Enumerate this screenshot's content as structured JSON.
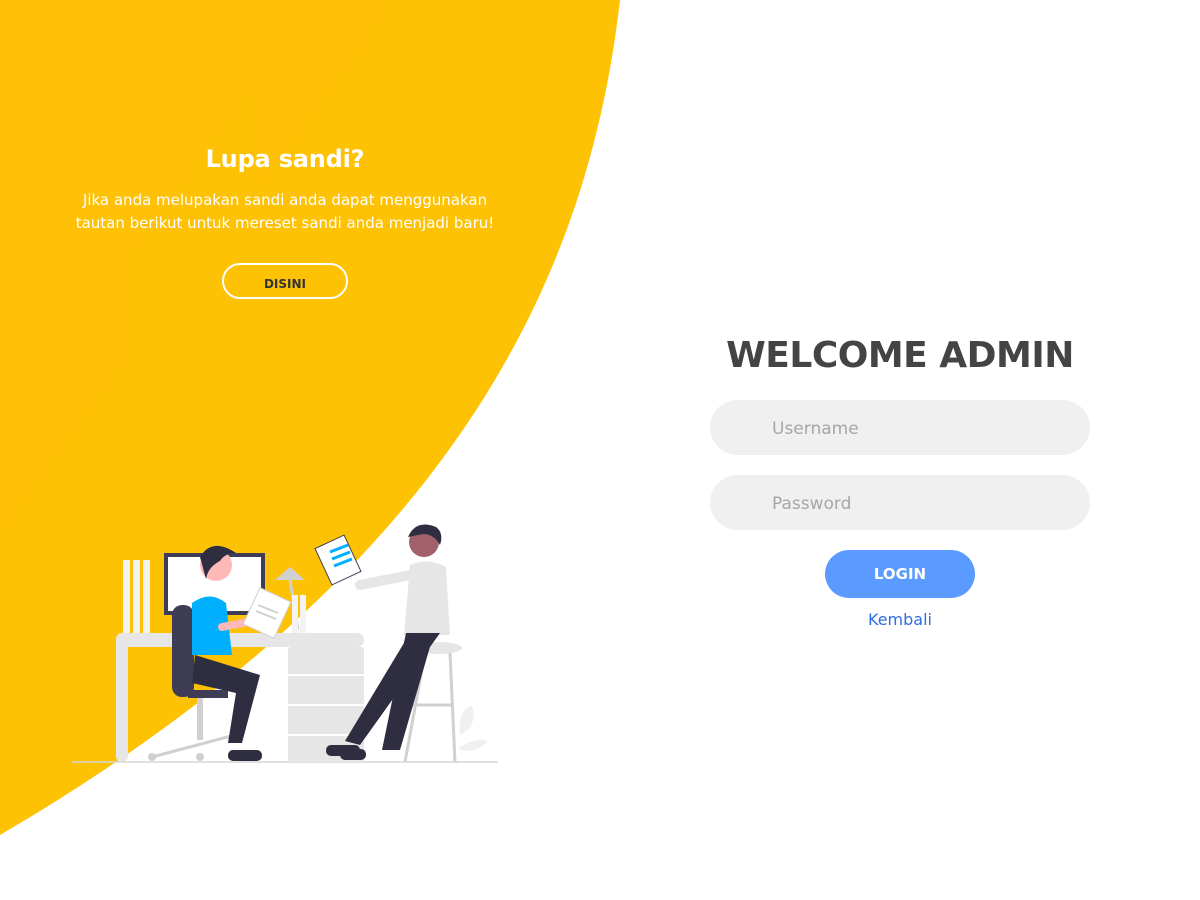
{
  "colors": {
    "accent": "#fcc200",
    "login_button": "#5b9bff",
    "link": "#2f6ee0",
    "title": "#444444"
  },
  "left_panel": {
    "title": "Lupa sandi?",
    "description": "Jika anda melupakan sandi anda dapat menggunakan tautan berikut untuk mereset sandi anda menjadi baru!",
    "button_label": "DISINI"
  },
  "illustration": {
    "name": "two-people-office-illustration"
  },
  "login": {
    "title": "WELCOME ADMIN",
    "username_placeholder": "Username",
    "password_placeholder": "Password",
    "login_label": "LOGIN",
    "back_label": "Kembali"
  }
}
